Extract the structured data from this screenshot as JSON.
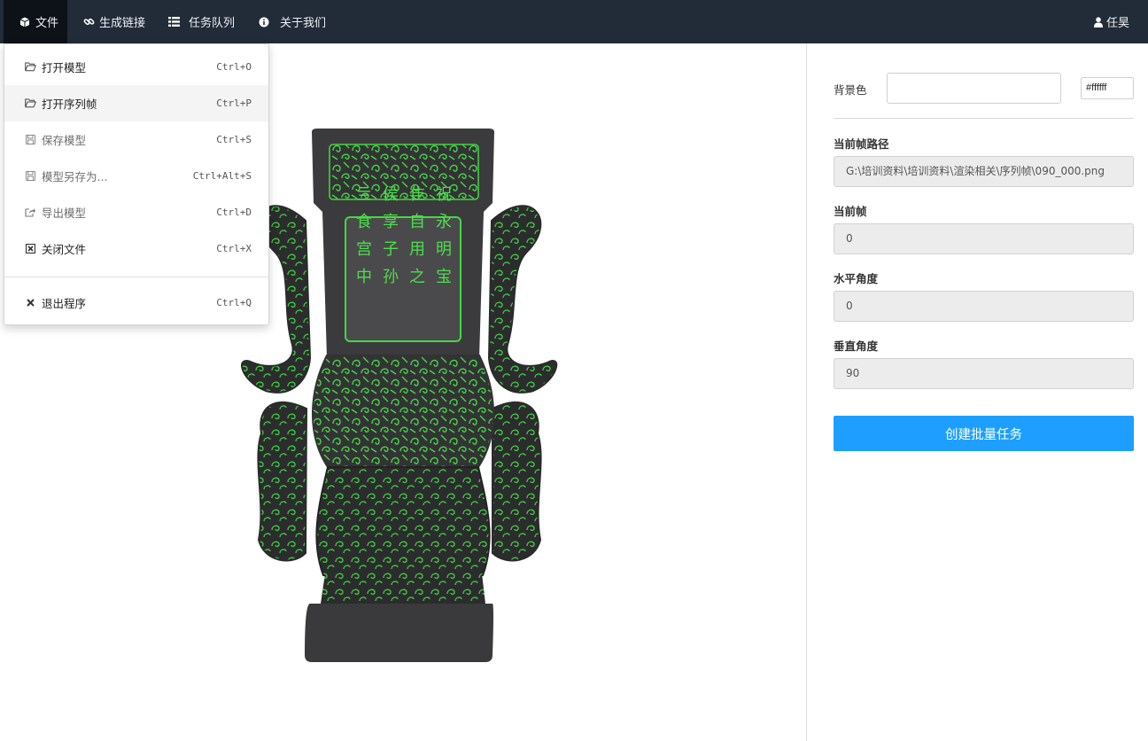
{
  "navbar": {
    "items": [
      {
        "label": "文件",
        "icon": "cube-icon"
      },
      {
        "label": "生成链接",
        "icon": "link-icon"
      },
      {
        "label": "任务队列",
        "icon": "list-icon"
      },
      {
        "label": "关于我们",
        "icon": "info-icon"
      }
    ],
    "user": {
      "label": "任昊",
      "icon": "user-icon"
    },
    "colors": {
      "background": "#222b38",
      "active": "#0d1118"
    }
  },
  "file_menu": {
    "items": [
      {
        "label": "打开模型",
        "shortcut": "Ctrl+O",
        "icon": "folder-open-icon"
      },
      {
        "label": "打开序列帧",
        "shortcut": "Ctrl+P",
        "icon": "folder-open-icon"
      },
      {
        "label": "保存模型",
        "shortcut": "Ctrl+S",
        "icon": "save-icon"
      },
      {
        "label": "模型另存为...",
        "shortcut": "Ctrl+Alt+S",
        "icon": "save-icon"
      },
      {
        "label": "导出模型",
        "shortcut": "Ctrl+D",
        "icon": "export-icon"
      },
      {
        "label": "关闭文件",
        "shortcut": "Ctrl+X",
        "icon": "close-square-icon"
      },
      {
        "label": "退出程序",
        "shortcut": "Ctrl+Q",
        "icon": "close-icon"
      }
    ]
  },
  "panel": {
    "bg_color_label": "背景色",
    "bg_color_value": "#ffffff",
    "bg_color_hex": "#ffffff",
    "frame_path_label": "当前帧路径",
    "frame_path_value": "G:\\培训资料\\培训资料\\渲染相关\\序列帧\\090_000.png",
    "frame_label": "当前帧",
    "frame_value": "0",
    "h_angle_label": "水平角度",
    "h_angle_value": "0",
    "v_angle_label": "垂直角度",
    "v_angle_value": "90",
    "create_button": "创建批量任务",
    "accent": "#1e9fff"
  },
  "viewer": {
    "model_icon": "bronze-vase-model",
    "model_colors": {
      "body": "#3b3b3d",
      "pattern": "#3fd13f"
    },
    "inscription": [
      "祝",
      "永",
      "明",
      "宝",
      "隹",
      "自",
      "用",
      "之",
      "侯",
      "享",
      "子",
      "孙",
      "亖",
      "食",
      "宫",
      "中"
    ]
  }
}
